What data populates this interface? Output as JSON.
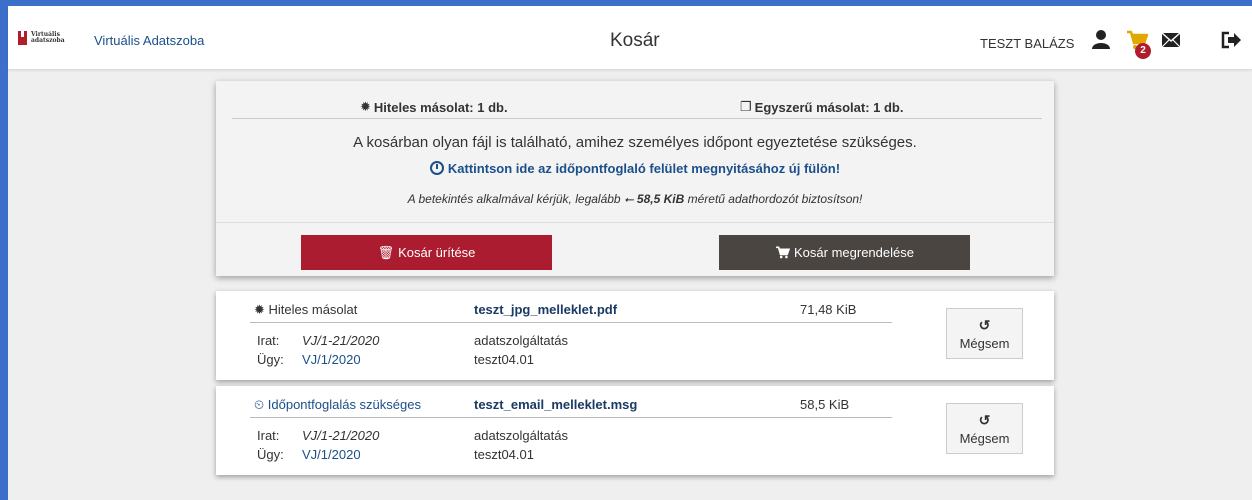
{
  "header": {
    "logo_text": "Virtuális adatszoba",
    "app_title": "Virtuális Adatszoba",
    "page_title": "Kosár",
    "user_name": "TESZT BALÁZS",
    "cart_count": "2"
  },
  "summary": {
    "certified_copies": "Hiteles másolat: 1 db.",
    "simple_copies": "Egyszerű másolat: 1 db.",
    "notice": "A kosárban olyan fájl is található, amihez személyes időpont egyeztetése szükséges.",
    "booking_link": "Kattintson ide az időpontfoglaló felület megnyitásához új fülön!",
    "hint_before": "A betekintés alkalmával kérjük, legalább",
    "hint_size": "58,5 KiB",
    "hint_after": "méretű adathordozót biztosítson!",
    "empty_button": "Kosár ürítése",
    "order_button": "Kosár megrendelése"
  },
  "items": [
    {
      "type": "Hiteles másolat",
      "file": "teszt_jpg_melleklet.pdf",
      "size": "71,48 KiB",
      "irat_label": "Irat:",
      "irat_value": "VJ/1-21/2020",
      "ugy_label": "Ügy:",
      "ugy_value": "VJ/1/2020",
      "desc1": "adatszolgáltatás",
      "desc2": "teszt04.01",
      "cancel": "Mégsem"
    },
    {
      "type": "Időpontfoglalás szükséges",
      "file": "teszt_email_melleklet.msg",
      "size": "58,5 KiB",
      "irat_label": "Irat:",
      "irat_value": "VJ/1-21/2020",
      "ugy_label": "Ügy:",
      "ugy_value": "VJ/1/2020",
      "desc1": "adatszolgáltatás",
      "desc2": "teszt04.01",
      "cancel": "Mégsem"
    }
  ],
  "icons": {
    "logo": "virtualis-adatszoba-logo-icon",
    "user": "user-icon",
    "cart": "cart-icon",
    "mail": "mail-icon",
    "logout": "logout-icon",
    "certified": "seal-icon",
    "simple": "copy-icon",
    "clock": "clock-icon",
    "usb": "usb-icon",
    "trash": "trash-icon",
    "undo": "undo-icon"
  },
  "colors": {
    "brand_red": "#ab1c30",
    "dark_button": "#4a4541",
    "link_blue": "#1b4f8a",
    "frame_blue": "#3b6fc9"
  }
}
